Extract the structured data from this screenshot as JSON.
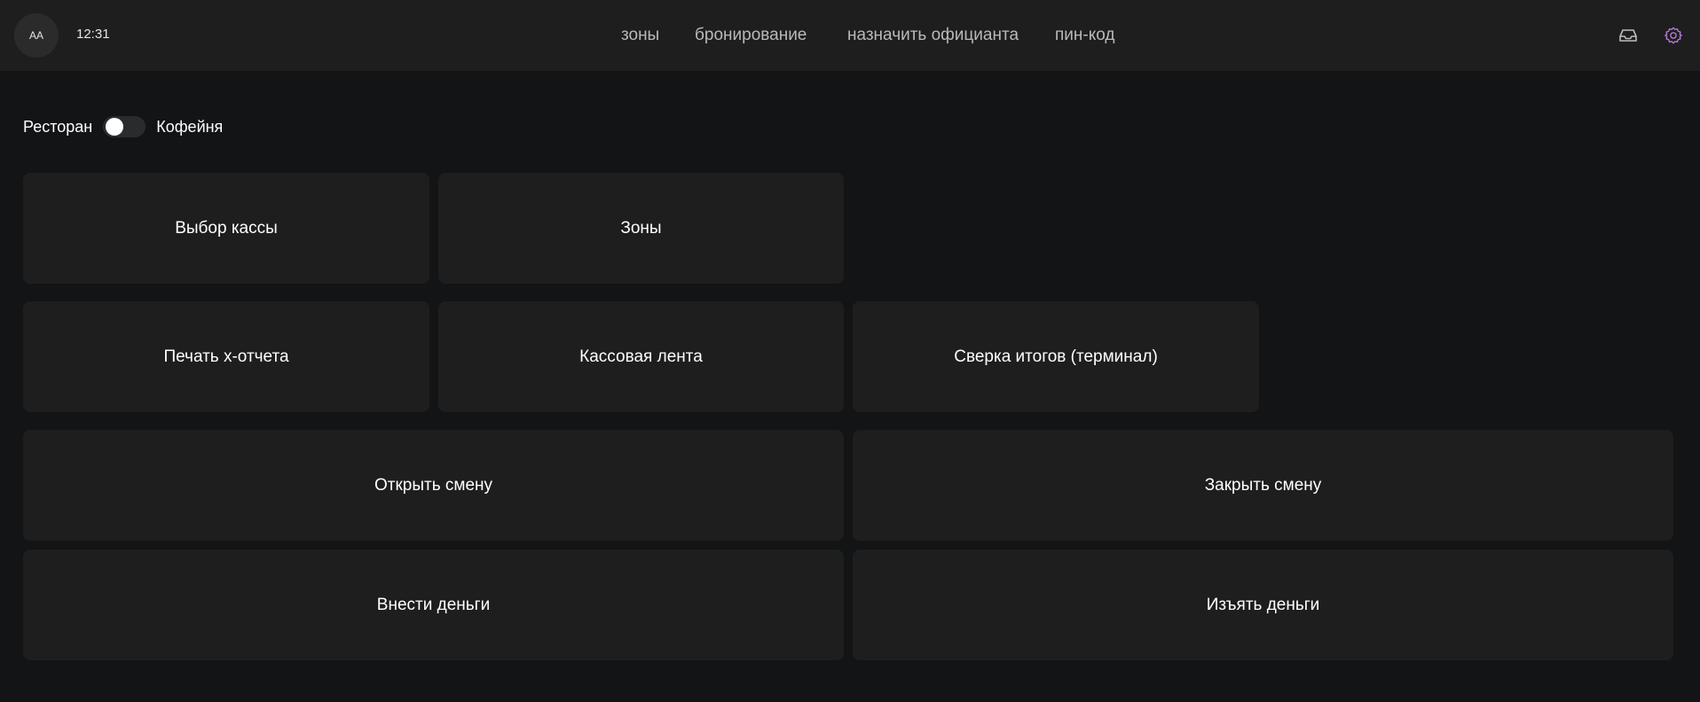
{
  "header": {
    "avatar_initials": "AA",
    "time": "12:31",
    "nav": [
      {
        "label": "зоны"
      },
      {
        "label": "бронирование"
      },
      {
        "label": "назначить официанта"
      },
      {
        "label": "пин-код"
      }
    ],
    "icons": {
      "inbox": "inbox-icon",
      "settings": "gear-icon"
    },
    "colors": {
      "settings_icon": "#b27ad9",
      "inbox_icon": "#bdbdbd"
    }
  },
  "mode_toggle": {
    "left_label": "Ресторан",
    "right_label": "Кофейня",
    "checked": false
  },
  "tiles": {
    "cash_select": "Выбор кассы",
    "zones": "Зоны",
    "print_x_report": "Печать x-отчета",
    "cash_tape": "Кассовая лента",
    "reconciliation": "Сверка итогов (терминал)",
    "open_shift": "Открыть смену",
    "close_shift": "Закрыть смену",
    "deposit_money": "Внести деньги",
    "withdraw_money": "Изъять деньги"
  },
  "colors": {
    "background": "#131416",
    "header": "#1e1e1e",
    "tile": "#1e1e1e",
    "text": "#ffffff",
    "nav_text": "#b9b9b9"
  }
}
